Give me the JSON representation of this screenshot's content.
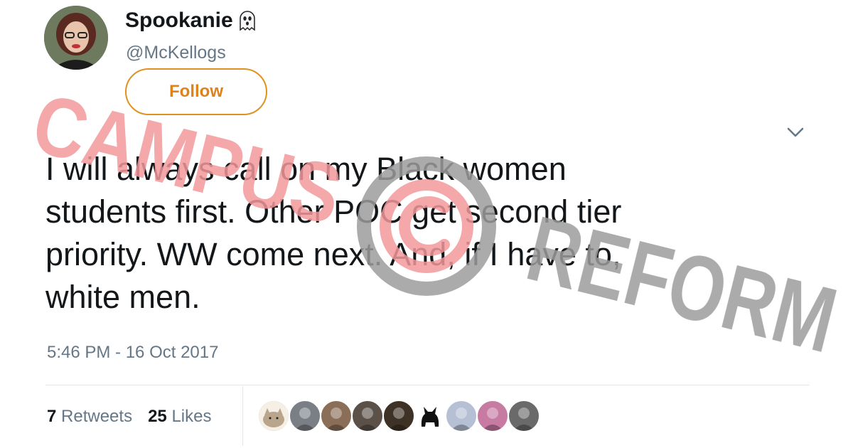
{
  "profile": {
    "display_name": "Spookanie",
    "display_name_emoji_icon": "ghost-icon",
    "handle": "@McKellogs",
    "follow_label": "Follow"
  },
  "tweet": {
    "text": "I will always call on my Black women\nstudents first. Other POC get second tier\npriority. WW come next. And, if I have to,\nwhite men.",
    "timestamp": "5:46 PM - 16 Oct 2017",
    "retweets_count": "7",
    "retweets_label": "Retweets",
    "likes_count": "25",
    "likes_label": "Likes"
  },
  "likers": [
    {
      "name": "cat-avatar",
      "color": "#c8b29a"
    },
    {
      "name": "liker-avatar-2",
      "color": "#7a7f86"
    },
    {
      "name": "liker-avatar-3",
      "color": "#8a6e57"
    },
    {
      "name": "liker-avatar-4",
      "color": "#5b5149"
    },
    {
      "name": "liker-avatar-5",
      "color": "#3e3126"
    },
    {
      "name": "black-cat-avatar",
      "color": "#ffffff"
    },
    {
      "name": "liker-avatar-7",
      "color": "#b6c0d4"
    },
    {
      "name": "liker-avatar-8",
      "color": "#c77aa2"
    },
    {
      "name": "liker-avatar-9",
      "color": "#6a6a6a"
    }
  ],
  "watermark": {
    "line1": "CAMPUS",
    "line2": "REFORM",
    "color_red": "#f2999b",
    "color_gray": "#9c9c9c"
  },
  "colors": {
    "follow_accent": "#e0921f",
    "secondary_text": "#657786"
  }
}
